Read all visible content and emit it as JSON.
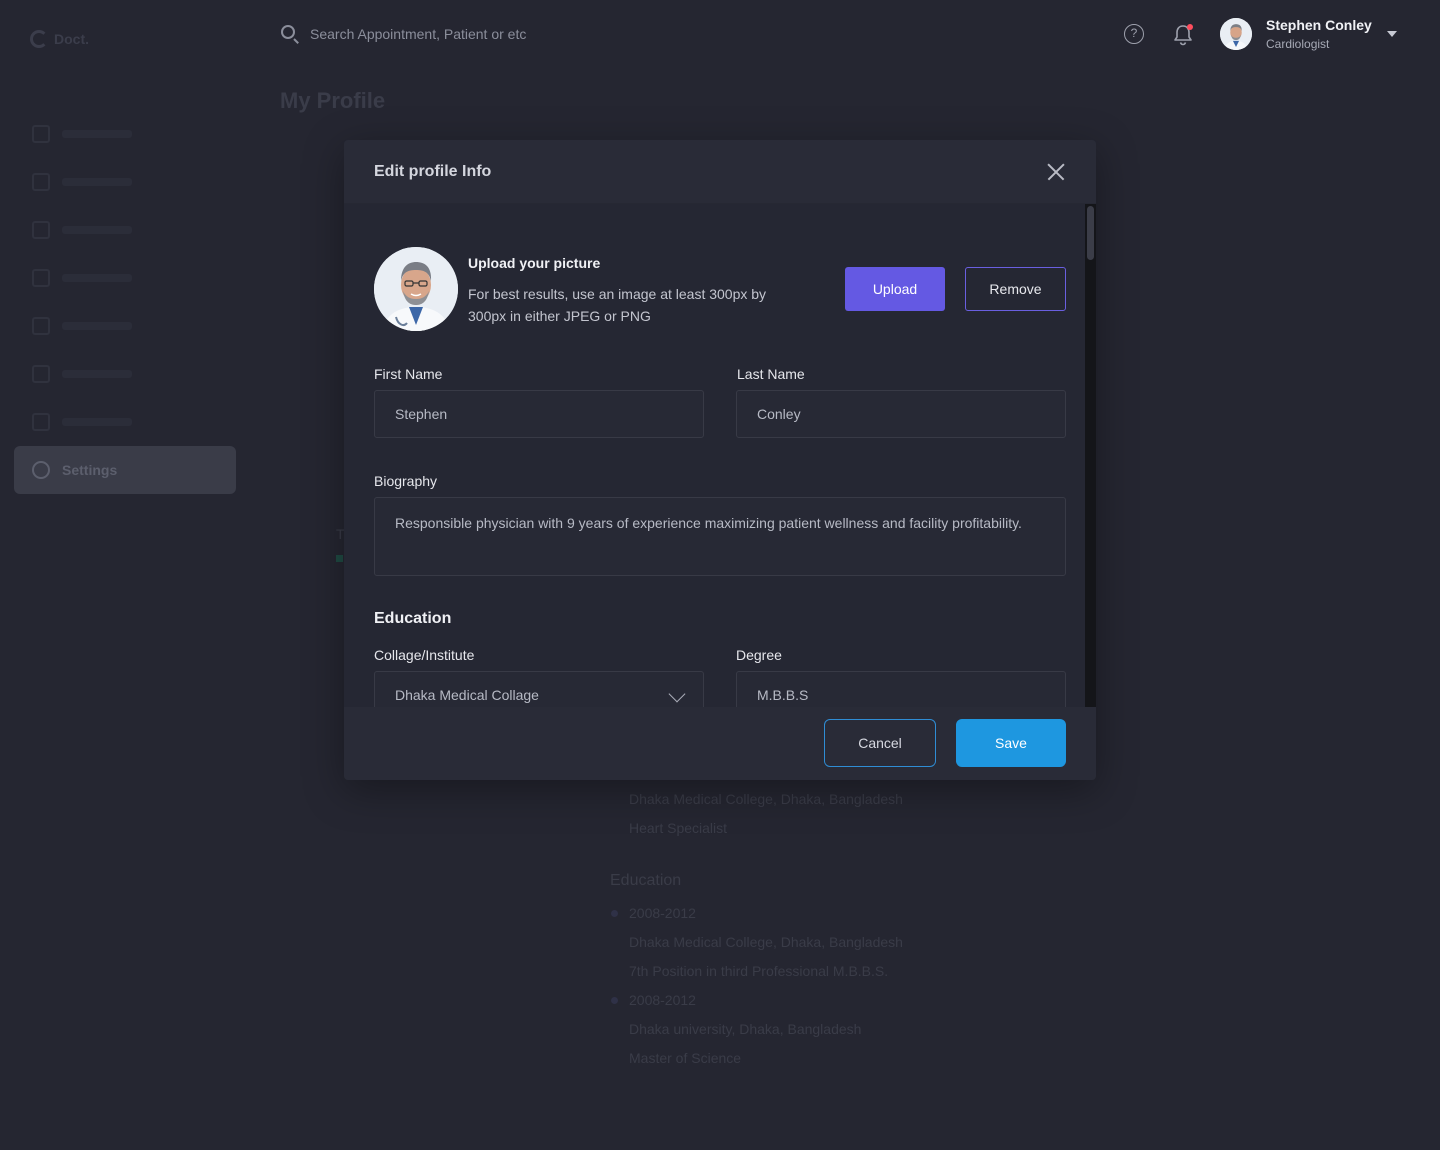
{
  "app": {
    "logo_text": "Doct."
  },
  "sidebar": {
    "active_label": "Settings"
  },
  "topbar": {
    "search_placeholder": "Search Appointment, Patient or etc",
    "help_glyph": "?",
    "user": {
      "name": "Stephen Conley",
      "role": "Cardiologist"
    }
  },
  "page": {
    "title": "My Profile",
    "background": {
      "t_char": "T",
      "lines": [
        {
          "text": "Dhaka Medical College, Dhaka, Bangladesh",
          "kind": "line"
        },
        {
          "text": "Heart Specialist",
          "kind": "line"
        },
        {
          "text": "Education",
          "kind": "head"
        },
        {
          "text": "2008-2012",
          "kind": "dot"
        },
        {
          "text": "Dhaka Medical College, Dhaka, Bangladesh",
          "kind": "line"
        },
        {
          "text": "7th Position in third Professional M.B.B.S.",
          "kind": "line"
        },
        {
          "text": "2008-2012",
          "kind": "dot"
        },
        {
          "text": "Dhaka university, Dhaka, Bangladesh",
          "kind": "line"
        },
        {
          "text": "Master of Science",
          "kind": "line"
        }
      ]
    }
  },
  "modal": {
    "title": "Edit profile Info",
    "upload": {
      "title": "Upload your picture",
      "hint": "For best results, use an image at least 300px by 300px in either JPEG or PNG",
      "upload_label": "Upload",
      "remove_label": "Remove"
    },
    "first_name": {
      "label": "First Name",
      "value": "Stephen"
    },
    "last_name": {
      "label": "Last Name",
      "value": "Conley"
    },
    "biography": {
      "label": "Biography",
      "value": "Responsible physician with 9 years of experience maximizing patient wellness and facility profitability."
    },
    "education": {
      "title": "Education",
      "institute": {
        "label": "Collage/Institute",
        "value": "Dhaka Medical Collage"
      },
      "degree": {
        "label": "Degree",
        "value": "M.B.B.S"
      }
    },
    "footer": {
      "cancel_label": "Cancel",
      "save_label": "Save"
    }
  },
  "colors": {
    "accent_purple": "#6459e3",
    "accent_blue": "#1e97e0",
    "background": "#252631",
    "notification_dot": "#ff4d5e"
  }
}
